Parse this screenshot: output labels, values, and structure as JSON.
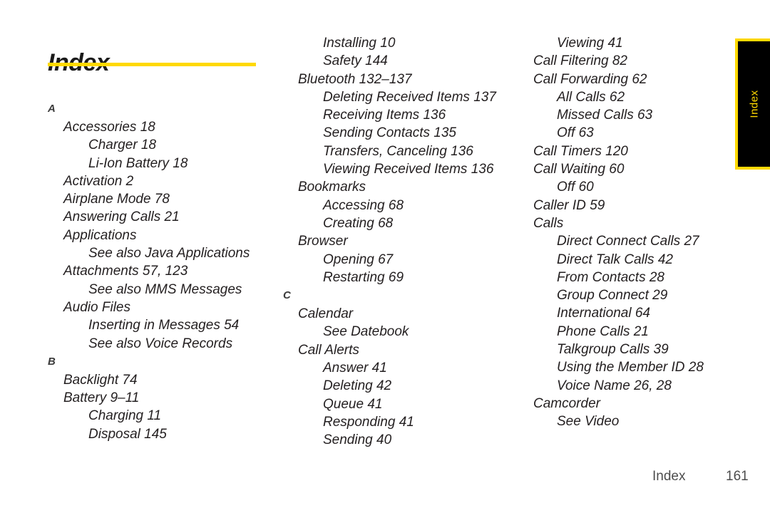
{
  "document": {
    "title": "Index",
    "side_tab_label": "Index",
    "accent_color": "#ffd900",
    "text_color": "#231f20",
    "tab_background": "#000000"
  },
  "footer": {
    "label": "Index",
    "page_number": "161"
  },
  "columns": [
    {
      "name": "column-1",
      "entries": [
        {
          "level": 0,
          "text": "A"
        },
        {
          "level": 1,
          "text": "Accessories 18"
        },
        {
          "level": 2,
          "text": "Charger 18"
        },
        {
          "level": 2,
          "text": "Li-Ion Battery 18"
        },
        {
          "level": 1,
          "text": "Activation 2"
        },
        {
          "level": 1,
          "text": "Airplane Mode 78"
        },
        {
          "level": 1,
          "text": "Answering Calls 21"
        },
        {
          "level": 1,
          "text": "Applications"
        },
        {
          "level": 2,
          "text": "See also Java Applications"
        },
        {
          "level": 1,
          "text": "Attachments 57, 123"
        },
        {
          "level": 2,
          "text": "See also MMS Messages"
        },
        {
          "level": 1,
          "text": "Audio Files"
        },
        {
          "level": 2,
          "text": "Inserting in Messages 54"
        },
        {
          "level": 2,
          "text": "See also Voice Records"
        },
        {
          "level": 0,
          "text": "B"
        },
        {
          "level": 1,
          "text": "Backlight 74"
        },
        {
          "level": 1,
          "text": "Battery 9–11"
        },
        {
          "level": 2,
          "text": "Charging 11"
        },
        {
          "level": 2,
          "text": "Disposal 145"
        }
      ]
    },
    {
      "name": "column-2",
      "entries": [
        {
          "level": 2,
          "text": "Installing 10"
        },
        {
          "level": 2,
          "text": "Safety 144"
        },
        {
          "level": 1,
          "text": "Bluetooth 132–137"
        },
        {
          "level": 2,
          "text": "Deleting Received Items 137"
        },
        {
          "level": 2,
          "text": "Receiving Items 136"
        },
        {
          "level": 2,
          "text": "Sending Contacts 135"
        },
        {
          "level": 2,
          "text": "Transfers, Canceling 136"
        },
        {
          "level": 2,
          "text": "Viewing Received Items 136"
        },
        {
          "level": 1,
          "text": "Bookmarks"
        },
        {
          "level": 2,
          "text": "Accessing 68"
        },
        {
          "level": 2,
          "text": "Creating 68"
        },
        {
          "level": 1,
          "text": "Browser"
        },
        {
          "level": 2,
          "text": "Opening 67"
        },
        {
          "level": 2,
          "text": "Restarting 69"
        },
        {
          "level": 0,
          "text": "C"
        },
        {
          "level": 1,
          "text": "Calendar"
        },
        {
          "level": 2,
          "text": "See Datebook"
        },
        {
          "level": 1,
          "text": "Call Alerts"
        },
        {
          "level": 2,
          "text": "Answer 41"
        },
        {
          "level": 2,
          "text": "Deleting 42"
        },
        {
          "level": 2,
          "text": "Queue 41"
        },
        {
          "level": 2,
          "text": "Responding 41"
        },
        {
          "level": 2,
          "text": "Sending 40"
        }
      ]
    },
    {
      "name": "column-3",
      "entries": [
        {
          "level": 2,
          "text": "Viewing 41"
        },
        {
          "level": 1,
          "text": "Call Filtering 82"
        },
        {
          "level": 1,
          "text": "Call Forwarding 62"
        },
        {
          "level": 2,
          "text": "All Calls 62"
        },
        {
          "level": 2,
          "text": "Missed Calls 63"
        },
        {
          "level": 2,
          "text": "Off 63"
        },
        {
          "level": 1,
          "text": "Call Timers 120"
        },
        {
          "level": 1,
          "text": "Call Waiting 60"
        },
        {
          "level": 2,
          "text": "Off 60"
        },
        {
          "level": 1,
          "text": "Caller ID 59"
        },
        {
          "level": 1,
          "text": "Calls"
        },
        {
          "level": 2,
          "text": "Direct Connect Calls 27"
        },
        {
          "level": 2,
          "text": "Direct Talk Calls 42"
        },
        {
          "level": 2,
          "text": "From Contacts 28"
        },
        {
          "level": 2,
          "text": "Group Connect 29"
        },
        {
          "level": 2,
          "text": "International 64"
        },
        {
          "level": 2,
          "text": "Phone Calls 21"
        },
        {
          "level": 2,
          "text": "Talkgroup Calls 39"
        },
        {
          "level": 2,
          "text": "Using the Member ID 28"
        },
        {
          "level": 2,
          "text": "Voice Name 26, 28"
        },
        {
          "level": 1,
          "text": "Camcorder"
        },
        {
          "level": 2,
          "text": "See Video"
        }
      ]
    }
  ]
}
